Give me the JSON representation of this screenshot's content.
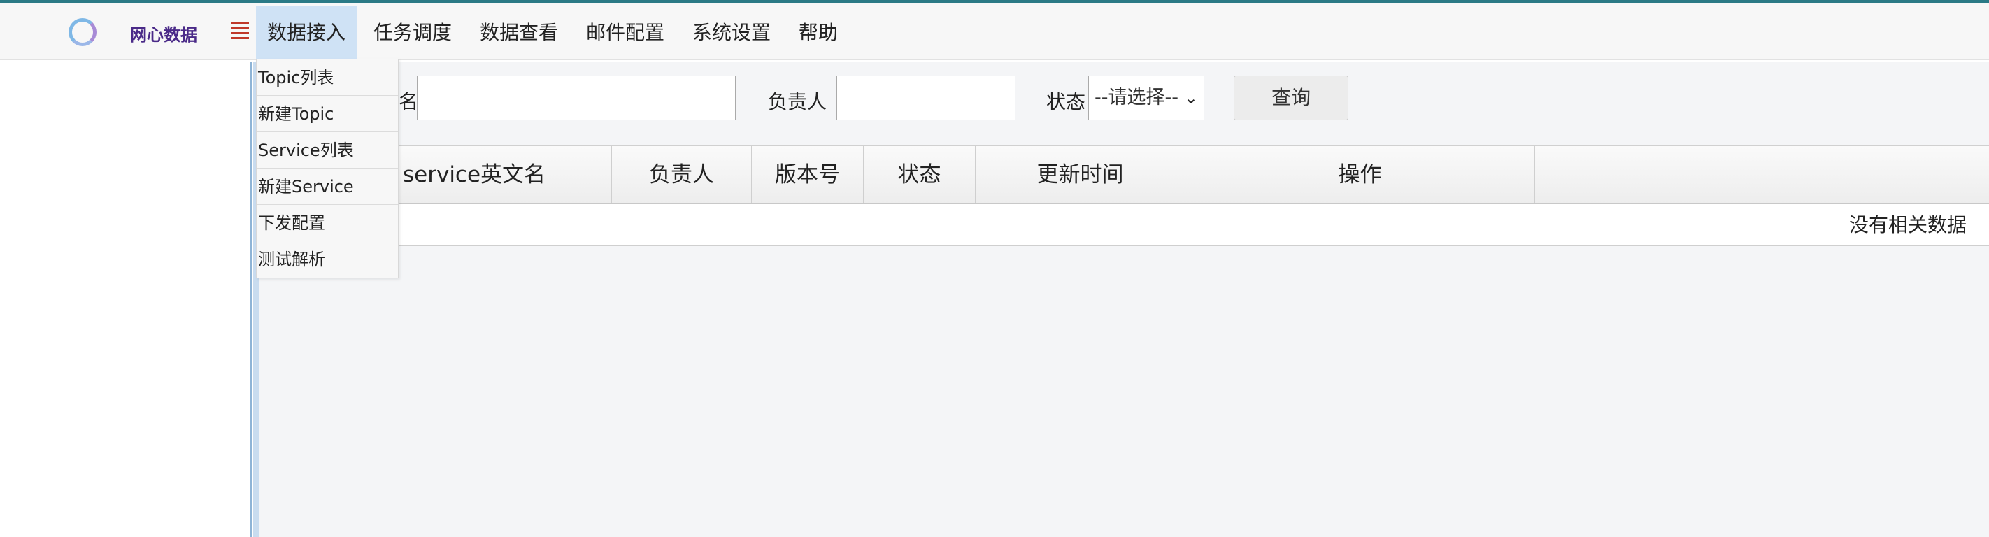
{
  "brand": {
    "name": "网心数据"
  },
  "nav": {
    "menu_icon": "hamburger-menu-icon",
    "items": [
      "数据接入",
      "任务调度",
      "数据查看",
      "邮件配置",
      "系统设置",
      "帮助"
    ]
  },
  "dropdown": {
    "items": [
      "Topic列表",
      "新建Topic",
      "Service列表",
      "新建Service",
      "下发配置",
      "测试解析"
    ]
  },
  "search": {
    "name_label_partial": "名",
    "owner_label": "负责人",
    "status_label": "状态",
    "status_value": "--请选择--",
    "query_button": "查询"
  },
  "table": {
    "columns": [
      "service英文名",
      "负责人",
      "版本号",
      "状态",
      "更新时间",
      "操作"
    ],
    "empty_text": "没有相关数据"
  },
  "colors": {
    "accent": "#2b7a86",
    "brand": "#4a2a88",
    "active_nav": "#cfe2f5",
    "menu_icon": "#c0392b"
  }
}
